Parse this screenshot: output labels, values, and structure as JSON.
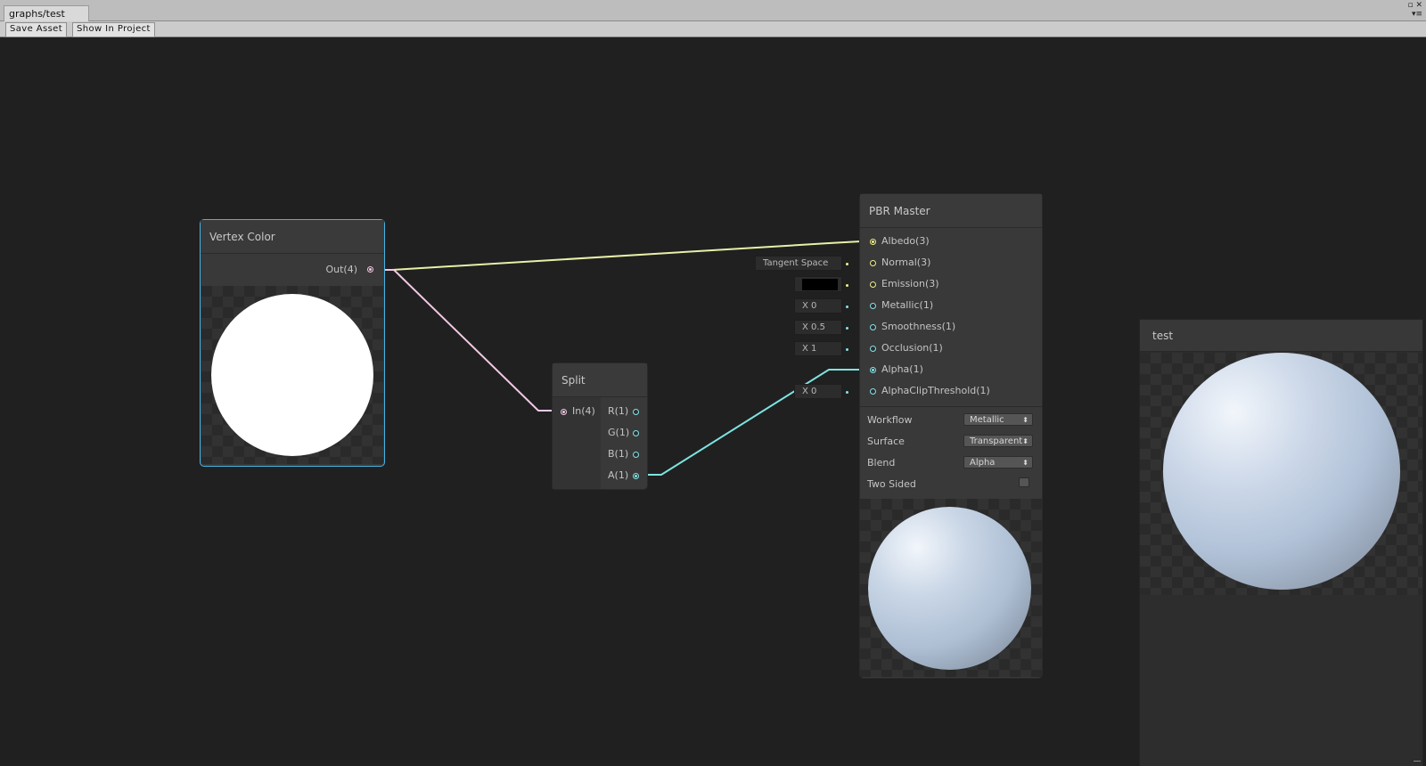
{
  "window": {
    "tab_title": "graphs/test",
    "toolbar": {
      "save_asset": "Save Asset",
      "show_in_project": "Show In Project"
    }
  },
  "colors": {
    "wire_vector": "#f1c9e4",
    "wire_color": "#e8f0a8",
    "wire_float": "#7ee3e0",
    "port_vec3": "#f1f08a",
    "port_float": "#84e4e7",
    "port_vec4": "#f3c9e6",
    "selection": "#44b4e4"
  },
  "nodes": {
    "vertex_color": {
      "title": "Vertex Color",
      "output": "Out(4)",
      "preview_icon": "white-disc-preview"
    },
    "split": {
      "title": "Split",
      "input": "In(4)",
      "outputs": [
        "R(1)",
        "G(1)",
        "B(1)",
        "A(1)"
      ]
    },
    "pbr_master": {
      "title": "PBR Master",
      "inputs": [
        "Albedo(3)",
        "Normal(3)",
        "Emission(3)",
        "Metallic(1)",
        "Smoothness(1)",
        "Occlusion(1)",
        "Alpha(1)",
        "AlphaClipThreshold(1)"
      ],
      "input_fields": {
        "normal": "Tangent Space",
        "metallic": "X 0",
        "smoothness": "X 0.5",
        "occlusion": "X 1",
        "alpha_clip": "X 0"
      },
      "settings": [
        {
          "label": "Workflow",
          "value": "Metallic"
        },
        {
          "label": "Surface",
          "value": "Transparent"
        },
        {
          "label": "Blend",
          "value": "Alpha"
        }
      ],
      "two_sided_label": "Two Sided",
      "two_sided_checked": false
    }
  },
  "preview_panel": {
    "title": "test"
  }
}
